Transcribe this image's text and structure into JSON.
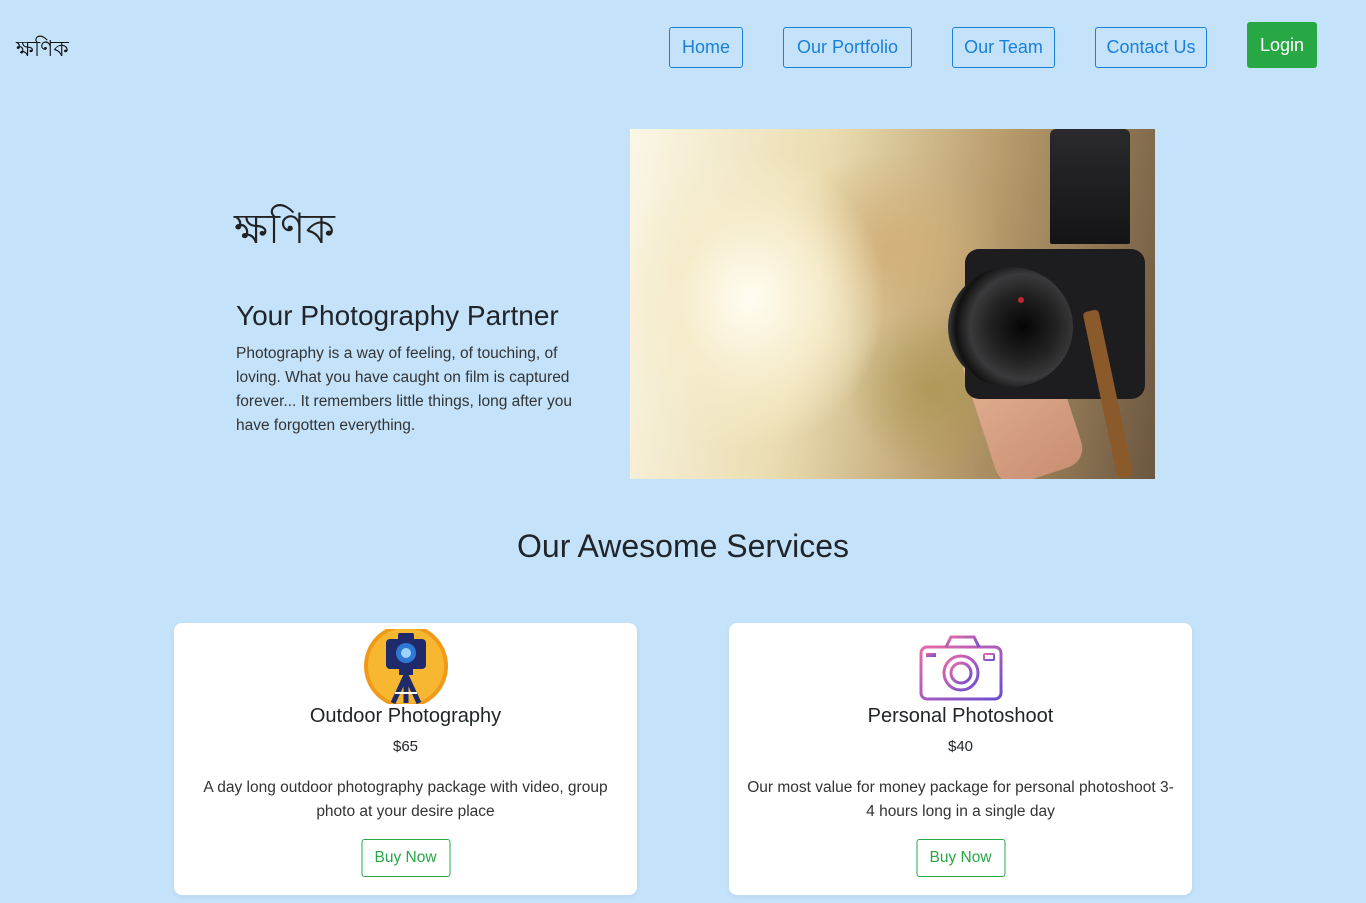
{
  "header": {
    "brand": "ক্ষণিক",
    "nav": [
      "Home",
      "Our Portfolio",
      "Our Team",
      "Contact Us"
    ],
    "login_label": "Login"
  },
  "hero": {
    "brand": "ক্ষণিক",
    "title": "Your Photography Partner",
    "text": "Photography is a way of feeling, of touching, of loving. What you have caught on film is captured forever... It remembers little things, long after you have forgotten everything."
  },
  "services": {
    "title": "Our Awesome Services",
    "cards": [
      {
        "icon": "tripod-camera-icon",
        "title": "Outdoor Photography",
        "price": "$65",
        "description": "A day long outdoor photography package with video, group photo at your desire place",
        "button": "Buy Now"
      },
      {
        "icon": "camera-outline-icon",
        "title": "Personal Photoshoot",
        "price": "$40",
        "description": "Our most value for money package for personal photoshoot 3-4 hours long in a single day",
        "button": "Buy Now"
      }
    ]
  },
  "colors": {
    "background": "#c4e3fb",
    "nav_accent": "#1a7fd6",
    "success": "#28a745"
  }
}
